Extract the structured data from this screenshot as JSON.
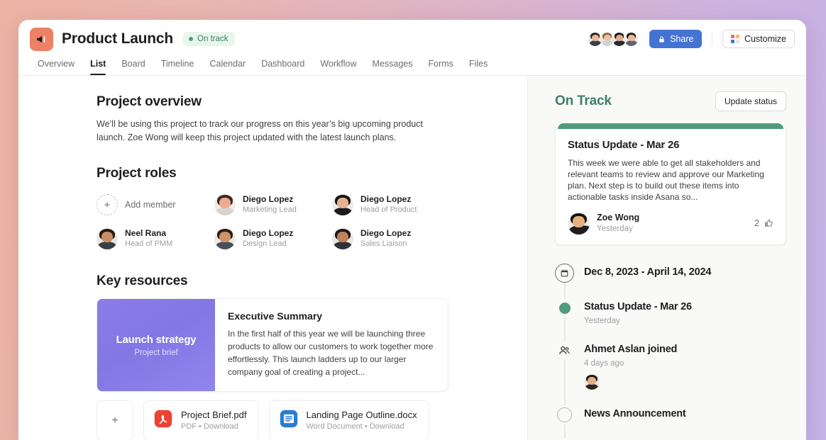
{
  "window": {
    "project_icon": "megaphone-icon",
    "title": "Product Launch",
    "status_badge": "On track",
    "accent_icon_color": "#ec8164"
  },
  "topbar": {
    "share_label": "Share",
    "share_icon": "lock-icon",
    "share_color": "#4573d2",
    "customize_label": "Customize",
    "customize_icon": "grid-icon",
    "members": [
      {
        "name": "member-1",
        "hair": "#2b2320",
        "skin": "#e7b79a",
        "shirt": "#3b3f4a",
        "bg": "#f1e7e1"
      },
      {
        "name": "member-2",
        "hair": "#8d6a43",
        "skin": "#edc2a2",
        "shirt": "#cfd4da",
        "bg": "#e8e6df"
      },
      {
        "name": "member-3",
        "hair": "#1d1a18",
        "skin": "#e2b089",
        "shirt": "#262b33",
        "bg": "#ece7e2"
      },
      {
        "name": "member-4",
        "hair": "#241c18",
        "skin": "#e9bb99",
        "shirt": "#5e6570",
        "bg": "#efe9e4"
      }
    ]
  },
  "tabs": [
    {
      "label": "Overview",
      "active": false
    },
    {
      "label": "List",
      "active": true
    },
    {
      "label": "Board",
      "active": false
    },
    {
      "label": "Timeline",
      "active": false
    },
    {
      "label": "Calendar",
      "active": false
    },
    {
      "label": "Dashboard",
      "active": false
    },
    {
      "label": "Workflow",
      "active": false
    },
    {
      "label": "Messages",
      "active": false
    },
    {
      "label": "Forms",
      "active": false
    },
    {
      "label": "Files",
      "active": false
    }
  ],
  "overview": {
    "heading": "Project overview",
    "text": "We’ll be using this project to track our progress on this year’s big upcoming product launch. Zoe Wong will keep this project updated with the latest launch plans."
  },
  "roles": {
    "heading": "Project roles",
    "add_member_label": "Add member",
    "members": [
      {
        "name": "Diego Lopez",
        "title": "Marketing Lead",
        "hair": "#3a2a22",
        "skin": "#eeab92",
        "shirt": "#d8d4cf",
        "bg": "#f2ebe7"
      },
      {
        "name": "Diego Lopez",
        "title": "Head of Product",
        "hair": "#17120f",
        "skin": "#e5b391",
        "shirt": "#1b1a1c",
        "bg": "#efe9e6"
      },
      {
        "name": "Neel Rana",
        "title": "Head of PMM",
        "hair": "#241812",
        "skin": "#c98e64",
        "shirt": "#3a3f46",
        "bg": "#ece6e2"
      },
      {
        "name": "Diego Lopez",
        "title": "Design Lead",
        "hair": "#2a1d16",
        "skin": "#cf9468",
        "shirt": "#4a5058",
        "bg": "#eee8e3"
      },
      {
        "name": "Diego Lopez",
        "title": "Sales Liaison",
        "hair": "#1f1813",
        "skin": "#bf8259",
        "shirt": "#2f3339",
        "bg": "#ece6e1"
      }
    ]
  },
  "resources": {
    "heading": "Key resources",
    "brief": {
      "cover_title": "Launch strategy",
      "cover_subtitle": "Project brief",
      "title": "Executive Summary",
      "text": "In the first half of this year we will be launching three products to allow our customers to work together more effortlessly. This launch ladders up to our larger company goal of creating a project..."
    },
    "add_file_label": "+",
    "files": [
      {
        "name": "Project Brief.pdf",
        "meta": "PDF  •  Download",
        "icon": "pdf-file-icon",
        "color": "#ea4335"
      },
      {
        "name": "Landing Page Outline.docx",
        "meta": "Word Document  •  Download",
        "icon": "word-file-icon",
        "color": "#2b7cd3"
      }
    ]
  },
  "sidebar": {
    "status_title": "On Track",
    "status_title_color": "#3c8066",
    "update_button": "Update status",
    "card": {
      "ribbon_color": "#4f9b7c",
      "title": "Status Update - Mar 26",
      "body": "This week we were able to get all stakeholders and relevant teams to review and approve our Marketing plan. Next step is to build out these items into actionable tasks inside Asana so...",
      "author": "Zoe Wong",
      "timestamp": "Yesterday",
      "like_count": "2",
      "like_icon": "thumbs-up-icon",
      "author_avatar": {
        "hair": "#16130f",
        "skin": "#e7b081",
        "shirt": "#201d1c",
        "bg": "#f0ece7"
      }
    },
    "timeline": [
      {
        "mark": "calendar-icon",
        "title": "Dec 8, 2023 - April 14, 2024",
        "subtitle": "",
        "avatar": null
      },
      {
        "mark": "status-dot-icon",
        "title": "Status Update - Mar 26",
        "subtitle": "Yesterday",
        "avatar": null
      },
      {
        "mark": "people-icon",
        "title": "Ahmet Aslan joined",
        "subtitle": "4 days ago",
        "avatar": {
          "hair": "#231a16",
          "skin": "#e4ae88",
          "shirt": "#2a2723",
          "bg": "#efe8e3"
        }
      },
      {
        "mark": "hollow-circle-icon",
        "title": "News Announcement",
        "subtitle": "",
        "avatar": null
      }
    ]
  }
}
